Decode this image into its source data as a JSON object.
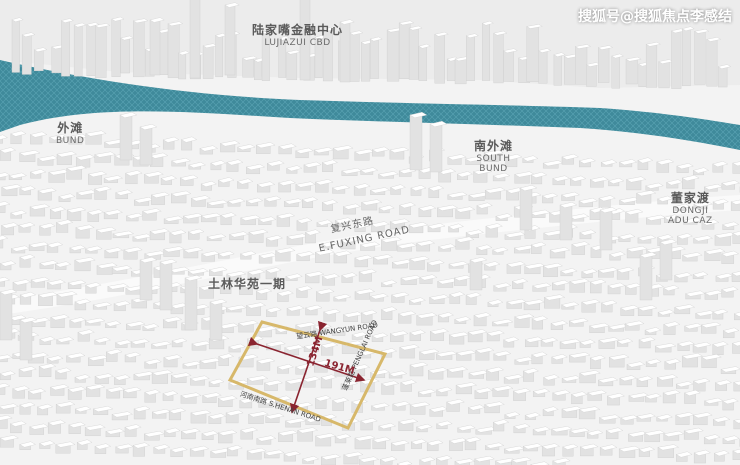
{
  "watermark": "搜狐号@搜狐焦点李感结",
  "districts": {
    "lujiazui": {
      "zh": "陆家嘴金融中心",
      "en": "LUJIAZUI CBD"
    },
    "bund": {
      "zh": "外滩",
      "en": "BUND"
    },
    "south_bund": {
      "zh": "南外滩",
      "en_1": "SOUTH",
      "en_2": "BUND"
    },
    "dongjiadu": {
      "zh": "董家渡",
      "en_1": "DONGJI",
      "en_2": "ADU CAZ"
    }
  },
  "roads": {
    "fuxing": {
      "zh": "复兴东路",
      "en": "E.FUXING ROAD"
    },
    "wangyun": {
      "zh": "望云路",
      "en": "WANGYUN ROAD"
    },
    "henan": {
      "zh": "河南南路",
      "en": "S.HENAN ROAD"
    },
    "penglai": {
      "zh": "蓬莱路",
      "en": "PENGLAI ROAD"
    }
  },
  "project": {
    "name": "土林华苑一期"
  },
  "dimensions": {
    "width": "191M",
    "height": "134M"
  },
  "colors": {
    "river": "#3f8a9b",
    "boundary": "#d7b86a",
    "measure": "#8a2430",
    "ground": "#f3f3f3"
  }
}
